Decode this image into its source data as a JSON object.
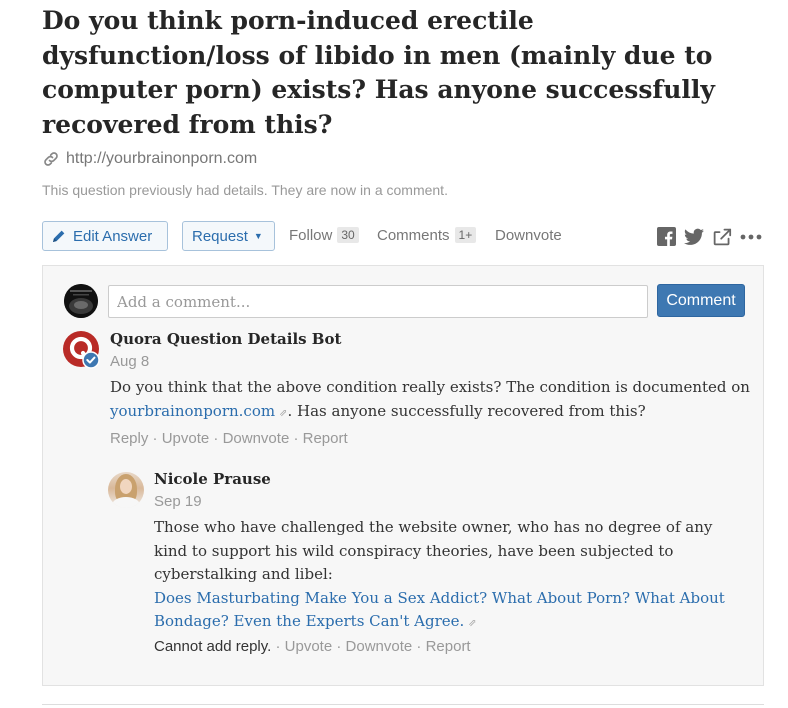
{
  "question": {
    "title": "Do you think porn-induced erectile dysfunction/loss of libido in men (mainly due to computer porn) exists? Has anyone successfully recovered from this?",
    "link_url": "http://yourbrainonporn.com",
    "details_note": "This question previously had details. They are now in a comment."
  },
  "actions": {
    "edit_answer": "Edit Answer",
    "request": "Request",
    "follow": "Follow",
    "follow_count": "30",
    "comments": "Comments",
    "comments_count": "1+",
    "downvote": "Downvote"
  },
  "share_icons": [
    "facebook-icon",
    "twitter-icon",
    "share-icon",
    "more-icon"
  ],
  "comment_box": {
    "placeholder": "Add a comment...",
    "button": "Comment"
  },
  "comments": [
    {
      "author": "Quora Question Details Bot",
      "date": "Aug 8",
      "body_before_link": "Do you think that the above condition really exists? The condition is documented on ",
      "link_text": "yourbrainonporn.com",
      "body_after_link": ". Has anyone successfully recovered from this?",
      "actions": [
        "Reply",
        "Upvote",
        "Downvote",
        "Report"
      ]
    },
    {
      "author": "Nicole Prause",
      "date": "Sep 19",
      "body": "Those who have challenged the website owner, who has no degree of any kind to support his wild conspiracy theories, have been subjected to cyberstalking and libel:",
      "link_text": "Does Masturbating Make You a Sex Addict? What About Porn? What About Bondage? Even the Experts Can't Agree.",
      "cannot_reply": "Cannot add reply.",
      "actions": [
        "Upvote",
        "Downvote",
        "Report"
      ]
    }
  ],
  "colors": {
    "link_blue": "#2b6dad",
    "button_blue": "#3e78b2",
    "bot_red": "#b92b27",
    "muted_gray": "#999999"
  }
}
